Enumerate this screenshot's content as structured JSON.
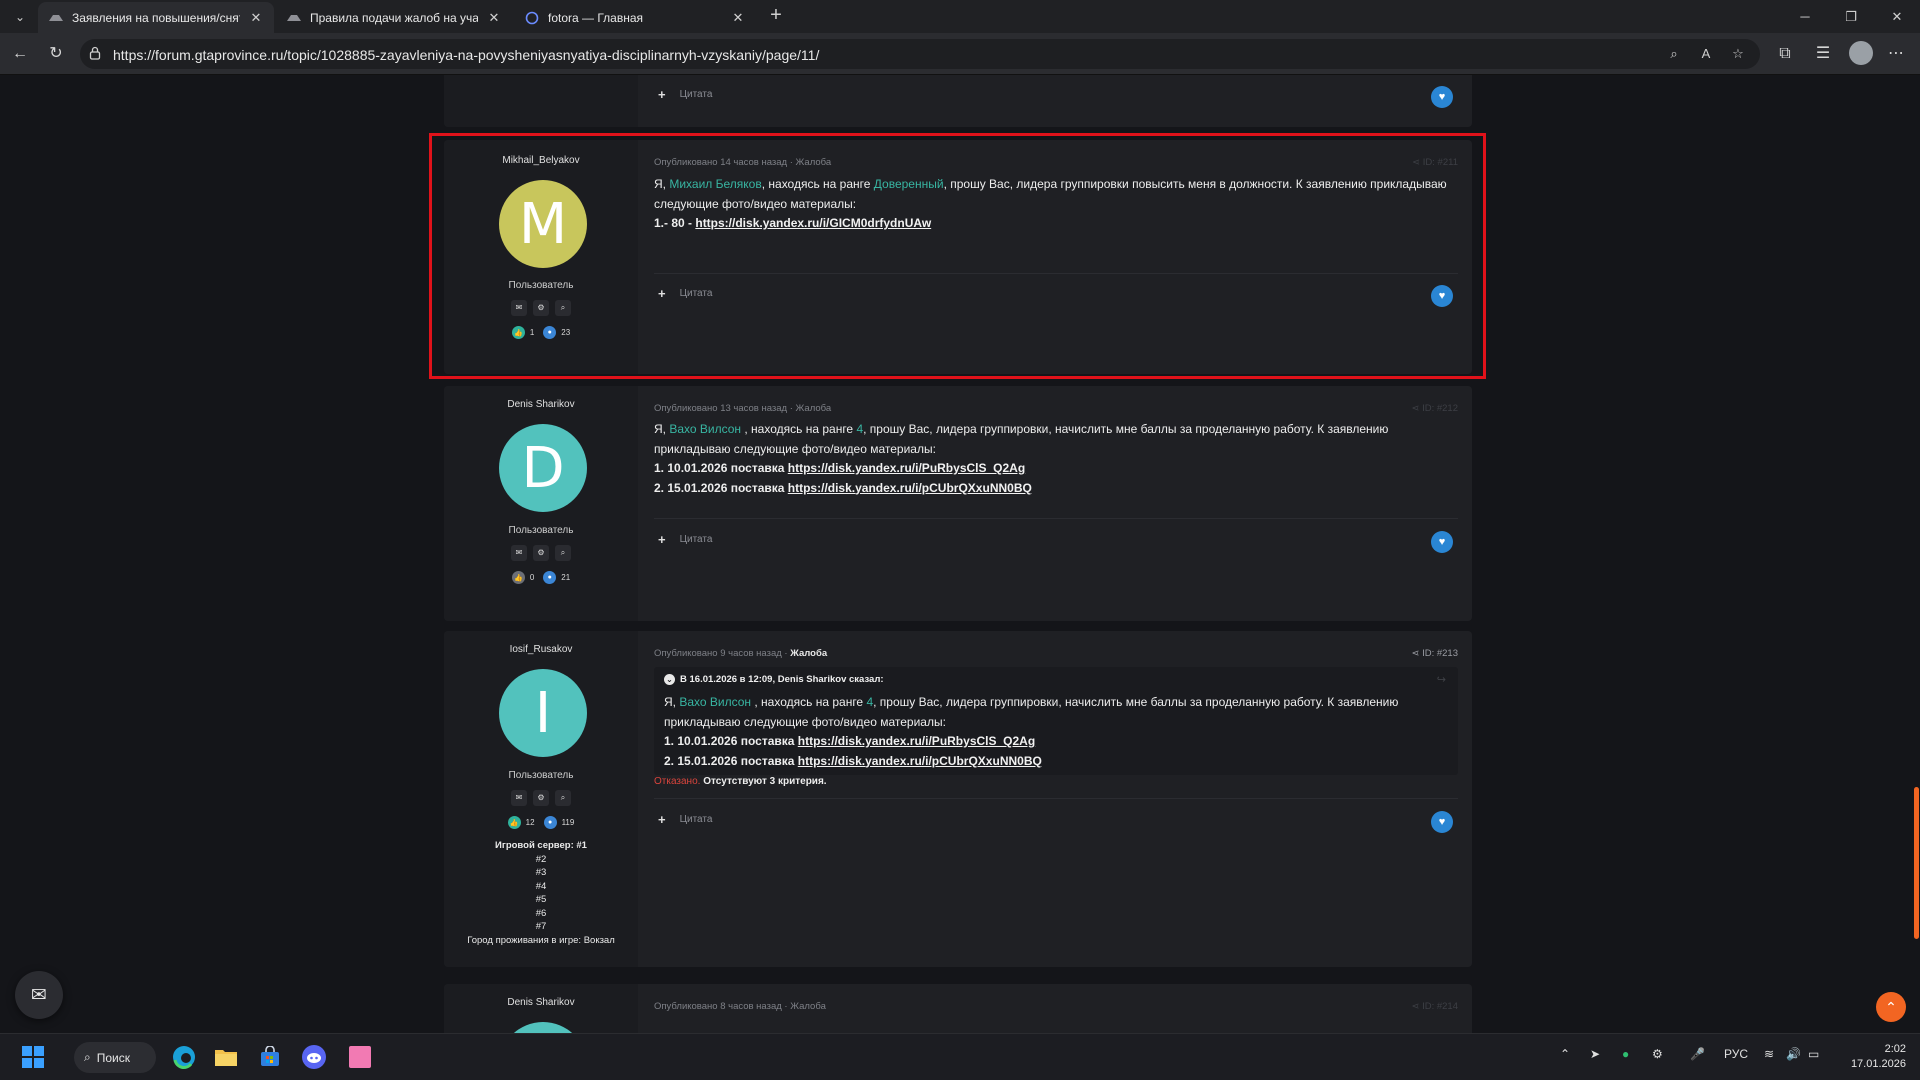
{
  "browser": {
    "tabs": [
      {
        "title": "Заявления на повышения/снятия"
      },
      {
        "title": "Правила подачи жалоб на участ"
      },
      {
        "title": "fotora — Главная"
      }
    ],
    "url": "https://forum.gtaprovince.ru/topic/1028885-zayavleniya-na-povysheniyasnyatiya-disciplinarnyh-vzyskaniy/page/11/"
  },
  "top_partial": {
    "quote_label": "Цитата"
  },
  "posts": [
    {
      "author": "Mikhail_Belyakov",
      "avatar_letter": "M",
      "avatar_color": "#c8c65c",
      "role": "Пользователь",
      "likes": "1",
      "posts_count": "23",
      "meta_time": "Опубликовано 14 часов назад",
      "meta_sep": " · ",
      "category": "Жалоба",
      "post_id": "ID: #211",
      "text": {
        "p1": "Я, ",
        "name": "Михаил Беляков",
        "p2": ", находясь на ранге ",
        "rank": "Доверенный",
        "p3": ", прошу Вас, лидера группировки повысить меня в должности. К заявлению прикладываю следующие фото/видео материалы:",
        "l1_prefix": "1.- 80 - ",
        "l1_link": "https://disk.yandex.ru/i/GICM0drfydnUAw"
      },
      "quote_label": "Цитата"
    },
    {
      "author": "Denis Sharikov",
      "avatar_letter": "D",
      "avatar_color": "#52c2bd",
      "role": "Пользователь",
      "likes": "0",
      "posts_count": "21",
      "meta_time": "Опубликовано 13 часов назад",
      "meta_sep": " · ",
      "category": "Жалоба",
      "post_id": "ID: #212",
      "text": {
        "p1": "Я, ",
        "name": "Вахо Вилсон",
        "p2": " , находясь на ранге ",
        "rank": "4",
        "p3": ", прошу Вас, лидера группировки, начислить мне баллы за проделанную работу. К заявлению прикладываю следующие фото/видео материалы:",
        "l1_prefix": "1. 10.01.2026 поставка ",
        "l1_link": "https://disk.yandex.ru/i/PuRbysClS_Q2Ag",
        "l2_prefix": "2. 15.01.2026 поставка ",
        "l2_link": "https://disk.yandex.ru/i/pCUbrQXxuNN0BQ"
      },
      "quote_label": "Цитата"
    },
    {
      "author": "Iosif_Rusakov",
      "avatar_letter": "I",
      "avatar_color": "#52c2bd",
      "role": "Пользователь",
      "likes": "12",
      "posts_count": "119",
      "meta_time": "Опубликовано 9 часов назад",
      "meta_sep": " · ",
      "category": "Жалоба",
      "post_id": "ID: #213",
      "extra_lines": [
        "Игровой сервер: #1",
        "#2",
        "#3",
        "#4",
        "#5",
        "#6",
        "#7",
        "Город проживания в игре: Вокзал"
      ],
      "quote": {
        "header": "В 16.01.2026 в 12:09, Denis Sharikov сказал:",
        "p1": "Я, ",
        "name": "Вахо Вилсон",
        "p2": " , находясь на ранге ",
        "rank": "4",
        "p3": ", прошу Вас, лидера группировки, начислить мне баллы за проделанную работу. К заявлению прикладываю следующие фото/видео материалы:",
        "l1_prefix": "1. 10.01.2026 поставка ",
        "l1_link": "https://disk.yandex.ru/i/PuRbysClS_Q2Ag",
        "l2_prefix": "2. 15.01.2026 поставка ",
        "l2_link": "https://disk.yandex.ru/i/pCUbrQXxuNN0BQ"
      },
      "verdict_status": "Отказано.",
      "verdict_reason": "Отсутствуют 3 критерия.",
      "quote_label": "Цитата"
    },
    {
      "author": "Denis Sharikov",
      "avatar_color": "#52c2bd",
      "meta_time": "Опубликовано 8 часов назад",
      "meta_sep": " · ",
      "category": "Жалоба",
      "post_id": "ID: #214"
    }
  ],
  "taskbar": {
    "search_label": "Поиск",
    "lang": "РУС",
    "time": "2:02",
    "date": "17.01.2026"
  },
  "colors": {
    "accent_green": "#38b5a2",
    "highlight_border": "#e0121a",
    "scroll_top": "#f26522",
    "heart": "#2a86d4"
  }
}
